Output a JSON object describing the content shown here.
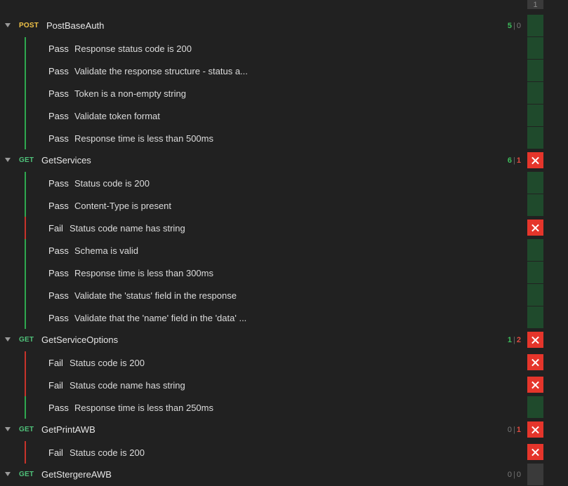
{
  "column_header": "1",
  "requests": [
    {
      "method": "POST",
      "name": "PostBaseAuth",
      "passed": "5",
      "failed": "0",
      "result": "pass",
      "tests": [
        {
          "status": "Pass",
          "name": "Response status code is 200"
        },
        {
          "status": "Pass",
          "name": "Validate the response structure - status a..."
        },
        {
          "status": "Pass",
          "name": "Token is a non-empty string"
        },
        {
          "status": "Pass",
          "name": "Validate token format"
        },
        {
          "status": "Pass",
          "name": "Response time is less than 500ms"
        }
      ]
    },
    {
      "method": "GET",
      "name": "GetServices",
      "passed": "6",
      "failed": "1",
      "result": "fail",
      "tests": [
        {
          "status": "Pass",
          "name": "Status code is 200"
        },
        {
          "status": "Pass",
          "name": "Content-Type is present"
        },
        {
          "status": "Fail",
          "name": "Status code name has string"
        },
        {
          "status": "Pass",
          "name": "Schema is valid"
        },
        {
          "status": "Pass",
          "name": "Response time is less than 300ms"
        },
        {
          "status": "Pass",
          "name": "Validate the 'status' field in the response"
        },
        {
          "status": "Pass",
          "name": "Validate that the 'name' field in the 'data' ..."
        }
      ]
    },
    {
      "method": "GET",
      "name": "GetServiceOptions",
      "passed": "1",
      "failed": "2",
      "result": "fail",
      "tests": [
        {
          "status": "Fail",
          "name": "Status code is 200"
        },
        {
          "status": "Fail",
          "name": "Status code name has string"
        },
        {
          "status": "Pass",
          "name": "Response time is less than 250ms"
        }
      ]
    },
    {
      "method": "GET",
      "name": "GetPrintAWB",
      "passed": "0",
      "failed": "1",
      "result": "fail",
      "tests": [
        {
          "status": "Fail",
          "name": "Status code is 200"
        }
      ]
    },
    {
      "method": "GET",
      "name": "GetStergereAWB",
      "passed": "0",
      "failed": "0",
      "result": "none",
      "tests": []
    }
  ],
  "colors": {
    "pass": "#3dbd5c",
    "fail": "#e5352b",
    "post": "#f1c348",
    "get": "#4fc27a"
  }
}
